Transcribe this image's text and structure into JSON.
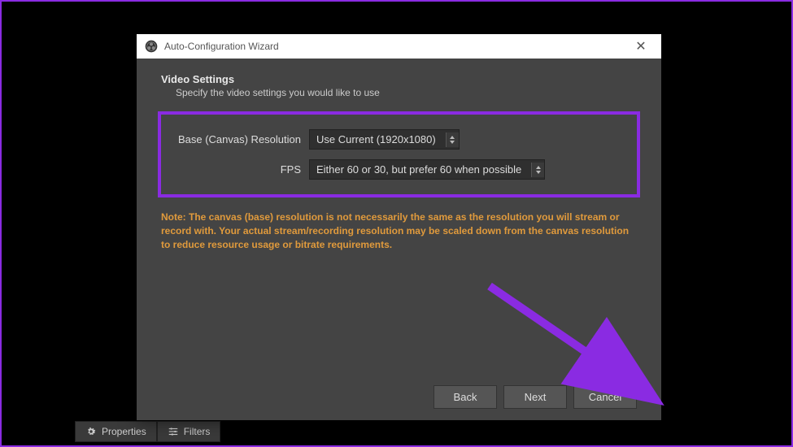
{
  "toolbar": {
    "properties": "Properties",
    "filters": "Filters"
  },
  "dialog": {
    "title": "Auto-Configuration Wizard",
    "heading": "Video Settings",
    "subheading": "Specify the video settings you would like to use",
    "fields": {
      "resolution": {
        "label": "Base (Canvas) Resolution",
        "value": "Use Current (1920x1080)"
      },
      "fps": {
        "label": "FPS",
        "value": "Either 60 or 30, but prefer 60 when possible"
      }
    },
    "note": "Note: The canvas (base) resolution is not necessarily the same as the resolution you will stream or record with. Your actual stream/recording resolution may be scaled down from the canvas resolution to reduce resource usage or bitrate requirements.",
    "buttons": {
      "back": "Back",
      "next": "Next",
      "cancel": "Cancel"
    }
  }
}
